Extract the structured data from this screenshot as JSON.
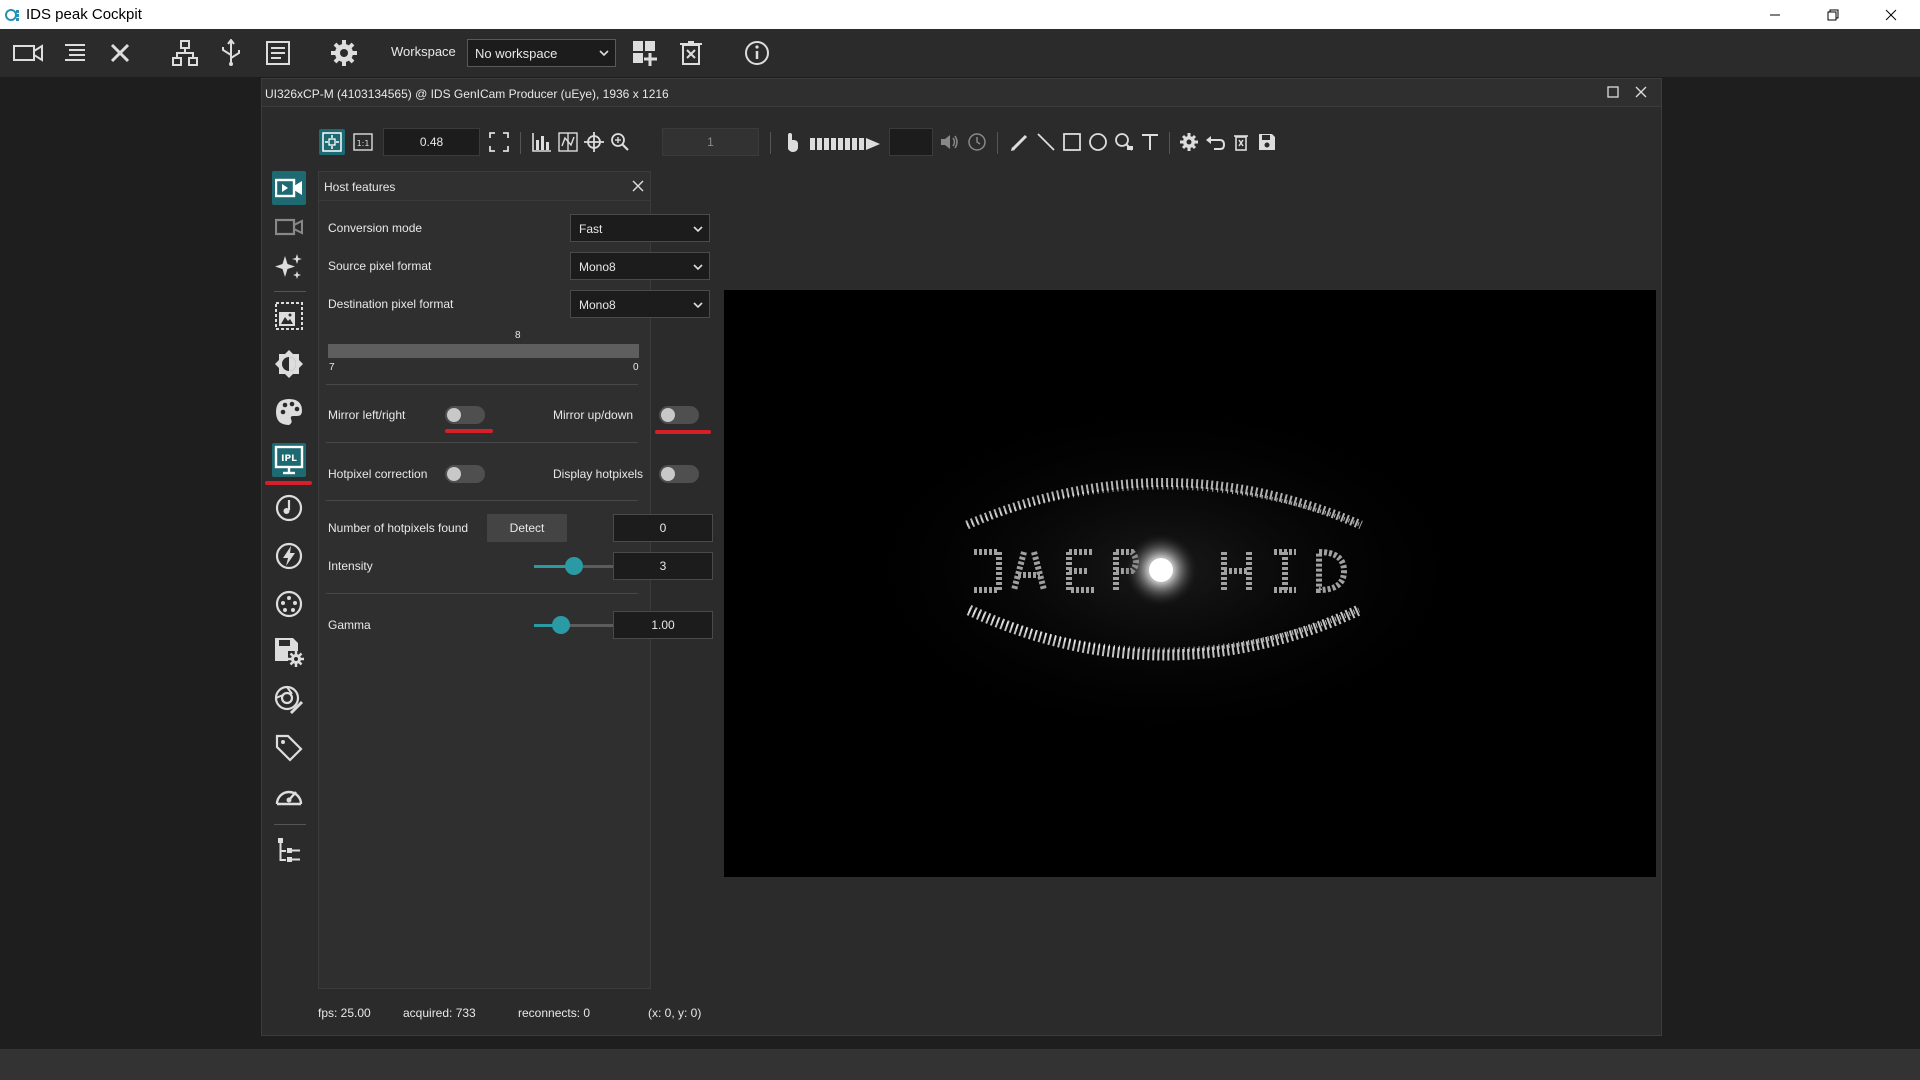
{
  "app": {
    "title": "IDS peak Cockpit"
  },
  "toolbar": {
    "workspace_label": "Workspace",
    "workspace_value": "No workspace"
  },
  "camera_window": {
    "title": "UI326xCP-M (4103134565) @ IDS GenICam Producer (uEye), 1936 x 1216",
    "zoom_value": "0.48",
    "frame_value": "1"
  },
  "host_features": {
    "title": "Host features",
    "conversion_mode": {
      "label": "Conversion mode",
      "value": "Fast"
    },
    "source_pixel_format": {
      "label": "Source pixel format",
      "value": "Mono8"
    },
    "destination_pixel_format": {
      "label": "Destination pixel format",
      "value": "Mono8"
    },
    "bit_range": {
      "top_value": "8",
      "left_value": "7",
      "right_value": "0"
    },
    "mirror_left_right": {
      "label": "Mirror left/right",
      "on": false
    },
    "mirror_up_down": {
      "label": "Mirror up/down",
      "on": false
    },
    "hotpixel_correction": {
      "label": "Hotpixel correction",
      "on": false
    },
    "display_hotpixels": {
      "label": "Display hotpixels",
      "on": false
    },
    "hotpixels_found": {
      "label": "Number of hotpixels found",
      "button": "Detect",
      "value": "0"
    },
    "intensity": {
      "label": "Intensity",
      "value": "3",
      "slider_fraction": 0.38
    },
    "gamma": {
      "label": "Gamma",
      "value": "1.00",
      "slider_fraction": 0.25
    }
  },
  "status": {
    "fps": "fps: 25.00",
    "acquired": "acquired: 733",
    "reconnects": "reconnects: 0",
    "coords": "(x: 0, y: 0)"
  },
  "colors": {
    "accent": "#2a9aa5",
    "active_icon_bg": "#1d6a72",
    "annotation_red": "#d81e2a"
  }
}
